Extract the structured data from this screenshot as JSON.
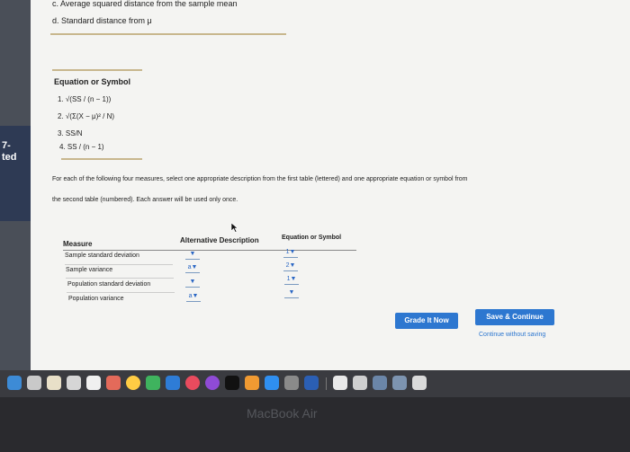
{
  "top_options": {
    "c": "c. Average squared distance from the sample mean",
    "d": "d. Standard distance from μ"
  },
  "equations": {
    "title": "Equation or Symbol",
    "items": [
      "1.  √(SS / (n − 1))",
      "2.  √(Σ(X − μ)² / N)",
      "3.  SS/N",
      "4.  SS / (n − 1)"
    ]
  },
  "instructions": {
    "line1": "For each of the following four measures, select one appropriate description from the first table (lettered) and one appropriate equation or symbol from",
    "line2": "the second table (numbered). Each answer will be used only once."
  },
  "answer_table": {
    "headers": {
      "measure": "Measure",
      "description": "Alternative Description",
      "equation": "Equation or Symbol"
    },
    "rows": [
      {
        "measure": "Sample standard deviation",
        "description": "",
        "equation": "1"
      },
      {
        "measure": "Sample variance",
        "description": "a",
        "equation": "2"
      },
      {
        "measure": "Population standard deviation",
        "description": "",
        "equation": "1"
      },
      {
        "measure": "Population variance",
        "description": "a",
        "equation": ""
      }
    ]
  },
  "buttons": {
    "grade": "Grade It Now",
    "save": "Save & Continue",
    "continue_link": "Continue without saving"
  },
  "sidebar": {
    "edge_text_top": "7-",
    "edge_text_bottom": "ted"
  },
  "laptop": {
    "label": "MacBook Air"
  },
  "dock": {
    "icons": [
      "finder-icon",
      "launchpad-icon",
      "safari-icon",
      "mail-icon",
      "calendar-icon",
      "notes-icon",
      "photos-icon",
      "numbers-icon",
      "keynote-icon",
      "music-icon",
      "podcasts-icon",
      "tv-icon",
      "books-icon",
      "app-store-icon",
      "preferences-icon",
      "word-icon",
      "trash-icon"
    ]
  }
}
